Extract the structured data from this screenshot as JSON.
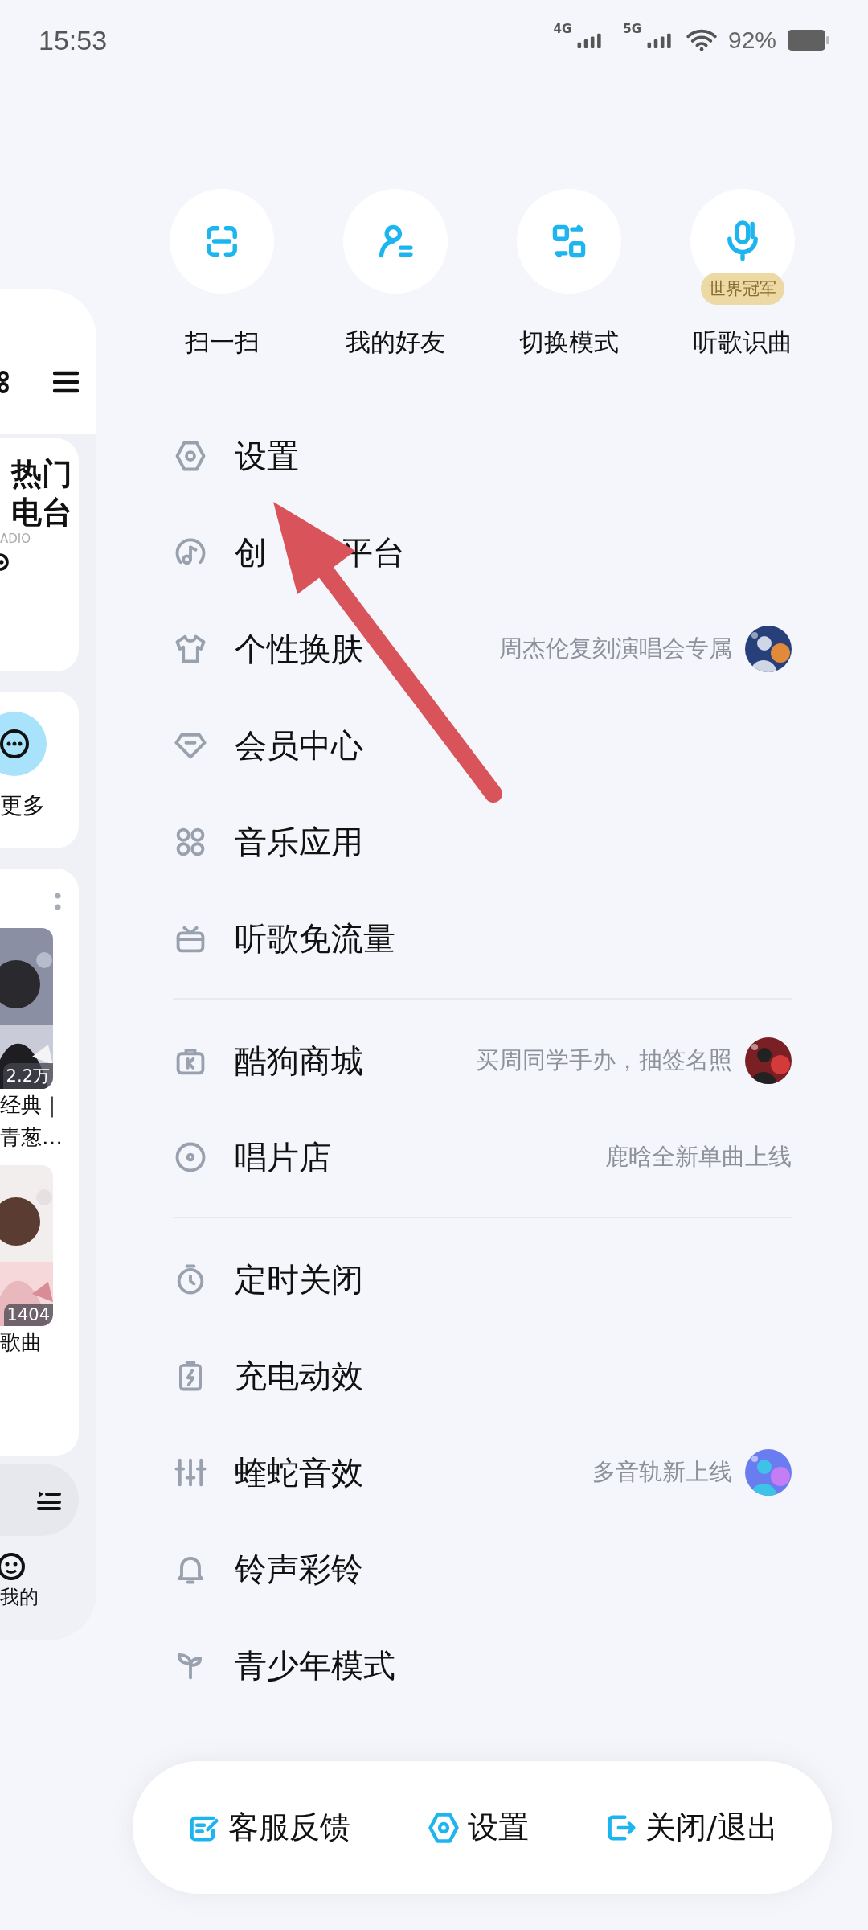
{
  "status_bar": {
    "time": "15:53",
    "network_1": "4G",
    "network_2": "5G",
    "battery": "92%"
  },
  "left_panel": {
    "radio_card": {
      "title_lines": [
        "热门",
        "电台"
      ],
      "subtitle": "ADIO"
    },
    "more_card": {
      "label": "更多"
    },
    "playlists": [
      {
        "count": "2.2万",
        "title_lines": [
          "经典｜",
          "青葱…"
        ]
      },
      {
        "count": "1404",
        "title_lines": [
          "歌曲"
        ]
      }
    ],
    "nav_label": "我的"
  },
  "shortcuts": [
    {
      "label": "扫一扫"
    },
    {
      "label": "我的好友"
    },
    {
      "label": "切换模式"
    },
    {
      "label": "听歌识曲",
      "badge": "世界冠军"
    }
  ],
  "menu": [
    {
      "items": [
        {
          "label": "设置"
        },
        {
          "label_parts": [
            "创",
            "平台"
          ]
        },
        {
          "label": "个性换肤",
          "hint": "周杰伦复刻演唱会专属"
        },
        {
          "label": "会员中心"
        },
        {
          "label": "音乐应用"
        },
        {
          "label": "听歌免流量"
        }
      ]
    },
    {
      "items": [
        {
          "label": "酷狗商城",
          "hint": "买周同学手办，抽签名照"
        },
        {
          "label": "唱片店",
          "hint": "鹿晗全新单曲上线"
        }
      ]
    },
    {
      "items": [
        {
          "label": "定时关闭"
        },
        {
          "label": "充电动效"
        },
        {
          "label": "蝰蛇音效",
          "hint": "多音轨新上线"
        },
        {
          "label": "铃声彩铃"
        },
        {
          "label": "青少年模式"
        }
      ]
    }
  ],
  "bottom_actions": [
    {
      "label": "客服反馈"
    },
    {
      "label": "设置"
    },
    {
      "label": "关闭/退出"
    }
  ]
}
